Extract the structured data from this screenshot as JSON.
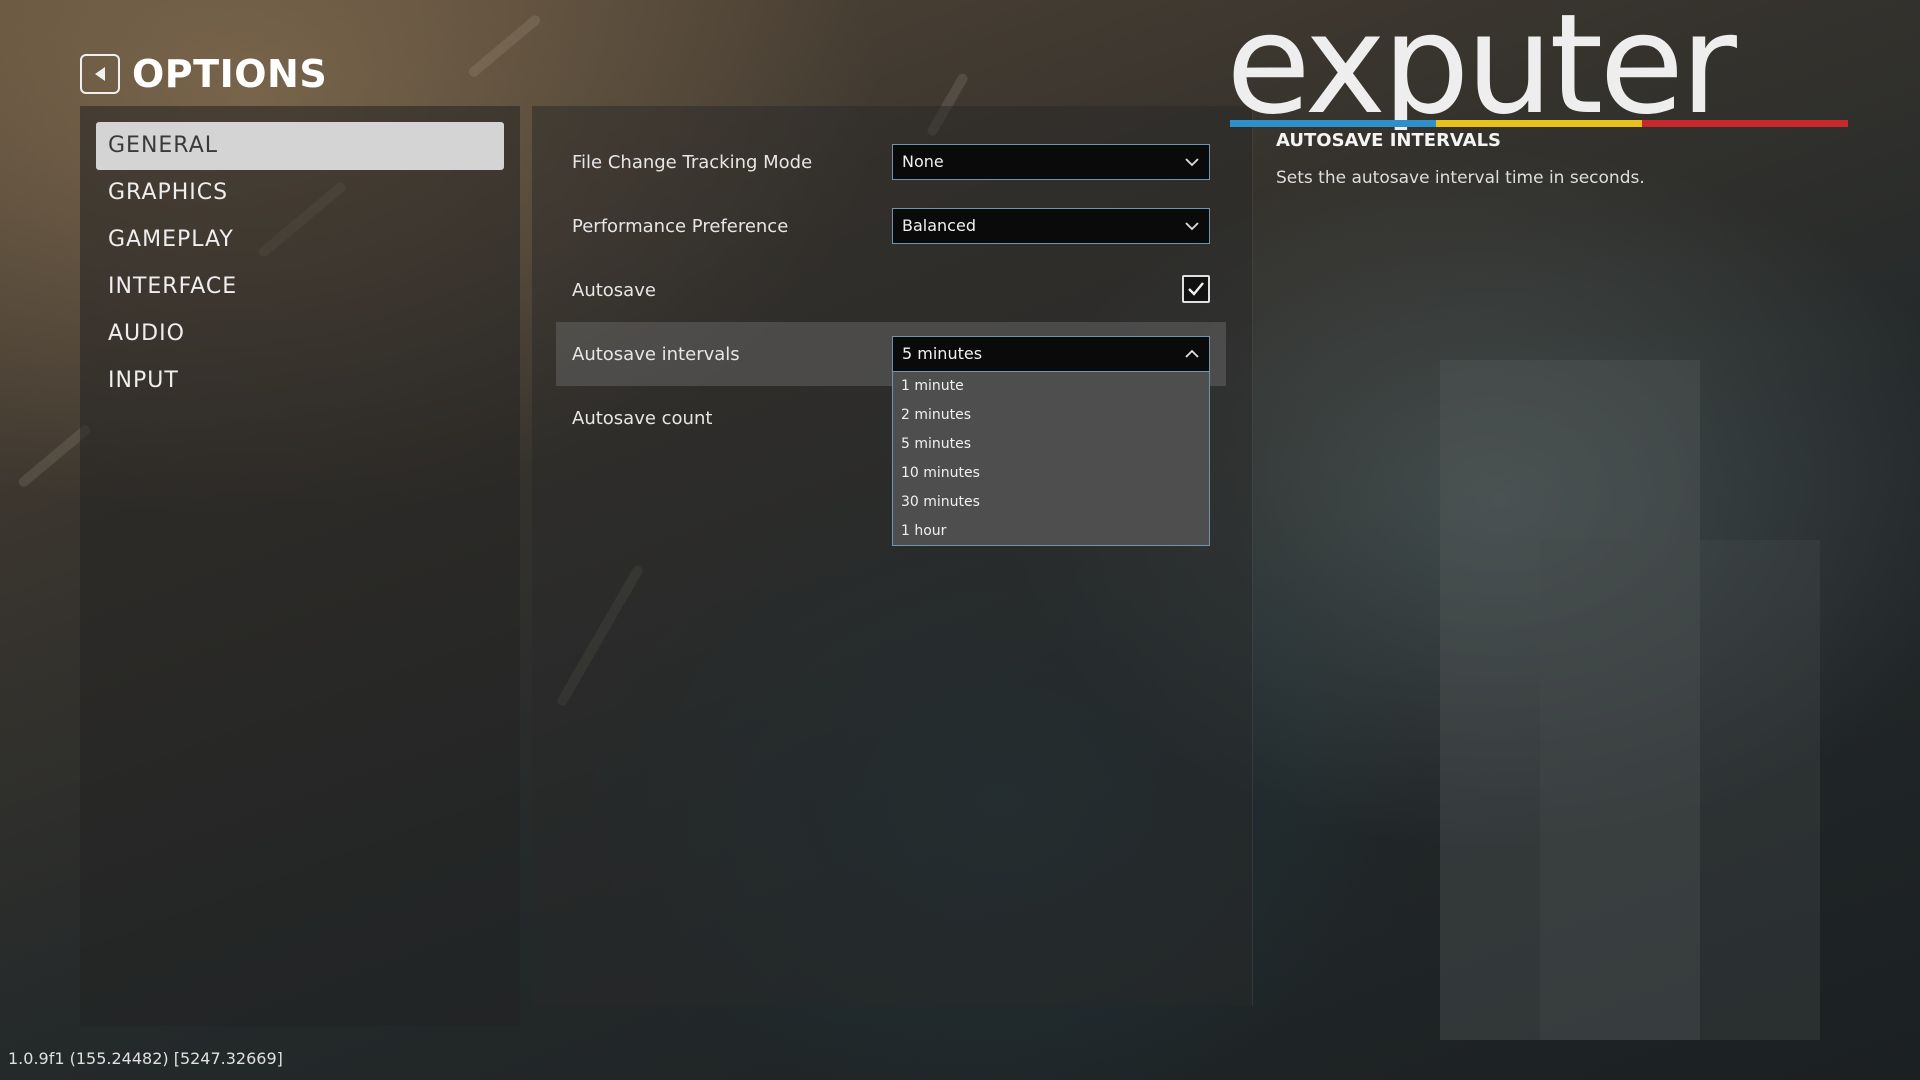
{
  "header": {
    "title": "OPTIONS"
  },
  "nav": {
    "items": [
      {
        "label": "GENERAL"
      },
      {
        "label": "GRAPHICS"
      },
      {
        "label": "GAMEPLAY"
      },
      {
        "label": "INTERFACE"
      },
      {
        "label": "AUDIO"
      },
      {
        "label": "INPUT"
      }
    ],
    "selected": "GENERAL"
  },
  "settings": {
    "file_change_tracking": {
      "label": "File Change Tracking Mode",
      "value": "None"
    },
    "performance": {
      "label": "Performance Preference",
      "value": "Balanced"
    },
    "autosave": {
      "label": "Autosave",
      "checked": true
    },
    "autosave_intervals": {
      "label": "Autosave intervals",
      "value": "5 minutes",
      "options": [
        "1 minute",
        "2 minutes",
        "5 minutes",
        "10 minutes",
        "30 minutes",
        "1 hour"
      ]
    },
    "autosave_count": {
      "label": "Autosave count"
    }
  },
  "info": {
    "title": "AUTOSAVE INTERVALS",
    "description": "Sets the autosave interval time in seconds."
  },
  "watermark": {
    "text": "exputer"
  },
  "version": "1.0.9f1 (155.24482) [5247.32669]",
  "colors": {
    "accent_border": "#6e95b0",
    "nav_active_bg": "#d4d4d4",
    "logo_blue": "#2f8fc8",
    "logo_yellow": "#e8c21a",
    "logo_red": "#c8282b"
  }
}
